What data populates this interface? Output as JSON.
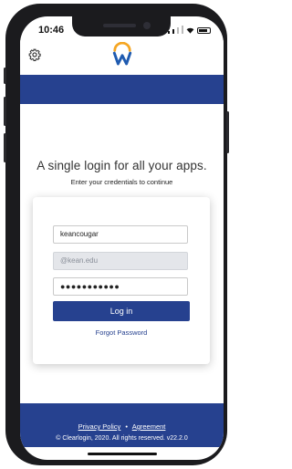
{
  "status_bar": {
    "time": "10:46"
  },
  "header": {
    "settings_icon": "gear-icon",
    "logo_icon": "workday-w-logo"
  },
  "login": {
    "headline": "A single login for all your apps.",
    "subheadline": "Enter your credentials to continue",
    "username_value": "keancougar",
    "domain_placeholder": "@kean.edu",
    "password_masked": "●●●●●●●●●●●",
    "login_button": "Log in",
    "forgot_password": "Forgot Password"
  },
  "footer": {
    "privacy_policy": "Privacy Policy",
    "separator": "•",
    "agreement": "Agreement",
    "copyright": "© Clearlogin, 2020. All rights reserved. v22.2.0"
  },
  "colors": {
    "brand_blue": "#26418f",
    "disabled_field": "#e4e6ea"
  }
}
